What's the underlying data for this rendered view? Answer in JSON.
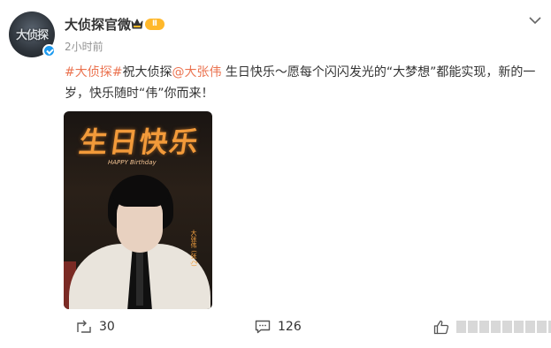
{
  "post": {
    "author": {
      "name": "大侦探官微",
      "avatar_text": "大侦探",
      "member_level": "Ⅱ",
      "verified": true
    },
    "time": "2小时前",
    "text": {
      "hashtag": "#大侦探#",
      "part1": "祝大侦探",
      "mention": "@大张伟",
      "part2": " 生日快乐～愿每个闪闪发光的“大梦想”都能实现，新的一岁，快乐随时“伟”你而来！"
    },
    "image": {
      "title": "生日快乐",
      "subtitle": "HAPPY Birthday",
      "side_name": "大张伟 (张 ζ)"
    },
    "actions": {
      "repost_count": "30",
      "comment_count": "126"
    }
  },
  "colors": {
    "accent": "#eb7350",
    "verified": "#1d9bf0",
    "badge": "#ffb82b",
    "muted": "#939393"
  },
  "icons": {
    "more": "chevron-down-icon",
    "repost": "repost-icon",
    "comment": "comment-icon",
    "like": "thumb-up-icon"
  }
}
